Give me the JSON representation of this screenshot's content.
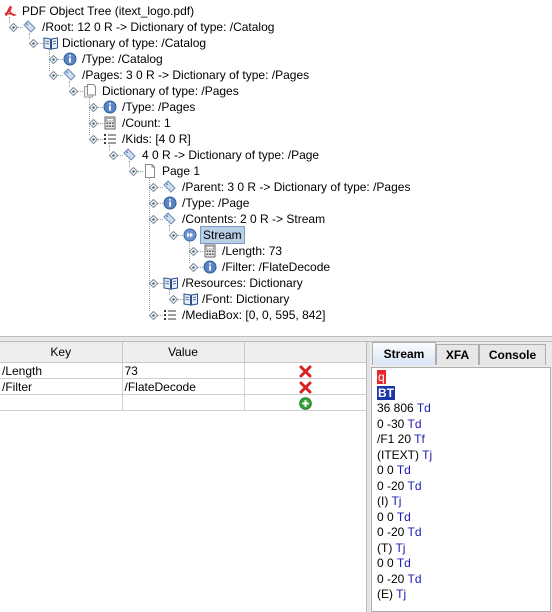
{
  "tree": {
    "nodes": [
      {
        "label": "PDF Object Tree (itext_logo.pdf)",
        "icon": "pdf-icon",
        "depth": 0
      },
      {
        "label": "/Root: 12 0 R -> Dictionary of type: /Catalog",
        "icon": "tag-icon",
        "depth": 1
      },
      {
        "label": "Dictionary of type: /Catalog",
        "icon": "book-icon",
        "depth": 2
      },
      {
        "label": "/Type: /Catalog",
        "icon": "info-icon",
        "depth": 3
      },
      {
        "label": "/Pages: 3 0 R -> Dictionary of type: /Pages",
        "icon": "tag-icon",
        "depth": 3
      },
      {
        "label": "Dictionary of type: /Pages",
        "icon": "pages-icon",
        "depth": 4
      },
      {
        "label": "/Type: /Pages",
        "icon": "info-icon",
        "depth": 5
      },
      {
        "label": "/Count: 1",
        "icon": "calculator-icon",
        "depth": 5
      },
      {
        "label": "/Kids: [4 0 R]",
        "icon": "list-icon",
        "depth": 5
      },
      {
        "label": "4 0 R -> Dictionary of type: /Page",
        "icon": "tag-icon",
        "depth": 6
      },
      {
        "label": "Page 1",
        "icon": "page-icon",
        "depth": 7
      },
      {
        "label": "/Parent: 3 0 R -> Dictionary of type: /Pages",
        "icon": "tag-icon",
        "depth": 8
      },
      {
        "label": "/Type: /Page",
        "icon": "info-icon",
        "depth": 8
      },
      {
        "label": "/Contents: 2 0 R -> Stream",
        "icon": "tag-icon",
        "depth": 8
      },
      {
        "label": "Stream",
        "icon": "stream-icon",
        "depth": 9,
        "selected": true
      },
      {
        "label": "/Length: 73",
        "icon": "calculator-icon",
        "depth": 10
      },
      {
        "label": "/Filter: /FlateDecode",
        "icon": "info-icon",
        "depth": 10
      },
      {
        "label": "/Resources: Dictionary",
        "icon": "book-icon",
        "depth": 8
      },
      {
        "label": "/Font: Dictionary",
        "icon": "book-icon",
        "depth": 9
      },
      {
        "label": "/MediaBox: [0, 0, 595, 842]",
        "icon": "list-icon",
        "depth": 8
      }
    ]
  },
  "table": {
    "headers": [
      "Key",
      "Value"
    ],
    "rows": [
      {
        "key": "/Length",
        "value": "73",
        "action": "delete"
      },
      {
        "key": "/Filter",
        "value": "/FlateDecode",
        "action": "delete"
      },
      {
        "key": "",
        "value": "",
        "action": "add"
      }
    ]
  },
  "tabs": [
    "Stream",
    "XFA",
    "Console"
  ],
  "stream": {
    "lines": [
      {
        "operands": "",
        "op": "q",
        "style": "red"
      },
      {
        "operands": "",
        "op": "BT",
        "style": "blue"
      },
      {
        "operands": "36 806",
        "op": "Td"
      },
      {
        "operands": "0 -30",
        "op": "Td"
      },
      {
        "operands": "/F1 20",
        "op": "Tf"
      },
      {
        "operands": "(ITEXT)",
        "op": "Tj"
      },
      {
        "operands": "0 0",
        "op": "Td"
      },
      {
        "operands": "0 -20",
        "op": "Td"
      },
      {
        "operands": "(I)",
        "op": "Tj"
      },
      {
        "operands": "0 0",
        "op": "Td"
      },
      {
        "operands": "0 -20",
        "op": "Td"
      },
      {
        "operands": "(T)",
        "op": "Tj"
      },
      {
        "operands": "0 0",
        "op": "Td"
      },
      {
        "operands": "0 -20",
        "op": "Td"
      },
      {
        "operands": "(E)",
        "op": "Tj"
      }
    ]
  },
  "colors": {
    "operator": "#1a1ab5",
    "highlight_red": "#e8262c",
    "highlight_blue": "#1c36a8",
    "selection": "#b8cfe5"
  }
}
